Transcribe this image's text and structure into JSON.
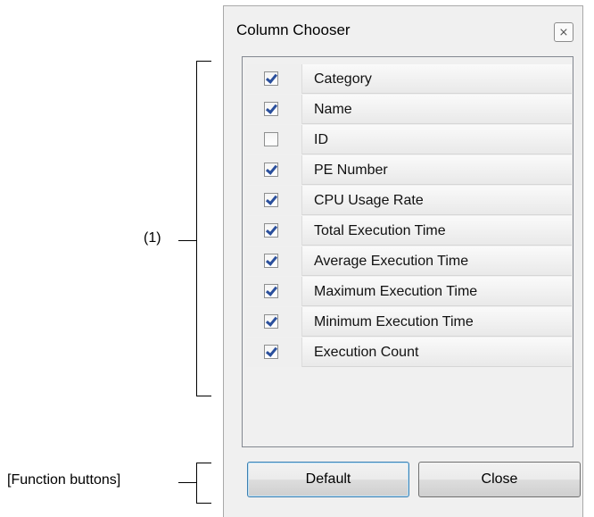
{
  "annotations": {
    "list_label": "(1)",
    "buttons_label": "[Function buttons]"
  },
  "dialog": {
    "title": "Column Chooser",
    "close_icon": "close-icon"
  },
  "columns": [
    {
      "label": "Category",
      "checked": true
    },
    {
      "label": "Name",
      "checked": true
    },
    {
      "label": "ID",
      "checked": false
    },
    {
      "label": "PE Number",
      "checked": true
    },
    {
      "label": "CPU Usage Rate",
      "checked": true
    },
    {
      "label": "Total Execution Time",
      "checked": true
    },
    {
      "label": "Average Execution Time",
      "checked": true
    },
    {
      "label": "Maximum Execution Time",
      "checked": true
    },
    {
      "label": "Minimum Execution Time",
      "checked": true
    },
    {
      "label": "Execution Count",
      "checked": true
    }
  ],
  "buttons": {
    "default_label": "Default",
    "close_label": "Close"
  }
}
